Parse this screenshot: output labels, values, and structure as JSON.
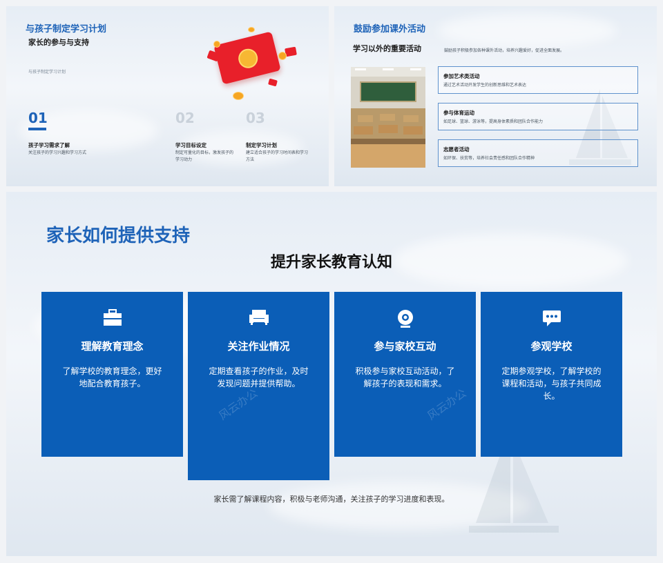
{
  "slide1": {
    "title": "与孩子制定学习计划",
    "subtitle": "家长的参与与支持",
    "small": "与孩子制定学习计划",
    "steps": [
      {
        "num": "01",
        "heading": "孩子学习需求了解",
        "desc": "关注孩子的学习兴趣和学习方式"
      },
      {
        "num": "02",
        "heading": "学习目标设定",
        "desc": "制定可量化的目标，激发孩子的学习动力"
      },
      {
        "num": "03",
        "heading": "制定学习计划",
        "desc": "建立适合孩子的学习时间表和学习方法"
      }
    ]
  },
  "slide2": {
    "title": "鼓励参加课外活动",
    "subtitle": "学习以外的重要活动",
    "desc": "鼓励孩子积极参加各种课外活动，培养兴趣爱好，促进全面发展。",
    "items": [
      {
        "heading": "参加艺术类活动",
        "desc": "通过艺术活动开发学生的创新思维和艺术表达"
      },
      {
        "heading": "参与体育运动",
        "desc": "如足球、篮球、游泳等，提高身体素质和团队合作能力"
      },
      {
        "heading": "志愿者活动",
        "desc": "如环保、扶贫等，培养社会责任感和团队合作精神"
      }
    ]
  },
  "slide3": {
    "title": "家长如何提供支持",
    "subtitle": "提升家长教育认知",
    "cards": [
      {
        "icon": "briefcase-icon",
        "heading": "理解教育理念",
        "desc": "了解学校的教育理念，更好地配合教育孩子。"
      },
      {
        "icon": "sofa-icon",
        "heading": "关注作业情况",
        "desc": "定期查看孩子的作业，及时发现问题并提供帮助。"
      },
      {
        "icon": "webcam-icon",
        "heading": "参与家校互动",
        "desc": "积极参与家校互动活动，了解孩子的表现和需求。"
      },
      {
        "icon": "chat-bubble-icon",
        "heading": "参观学校",
        "desc": "定期参观学校，了解学校的课程和活动，与孩子共同成长。"
      }
    ],
    "footer": "家长需了解课程内容，积极与老师沟通，关注孩子的学习进度和表现。",
    "watermark": "风云办公"
  },
  "colors": {
    "primary": "#0b5eb7",
    "title_blue": "#1e63b8",
    "red": "#e8202a"
  }
}
